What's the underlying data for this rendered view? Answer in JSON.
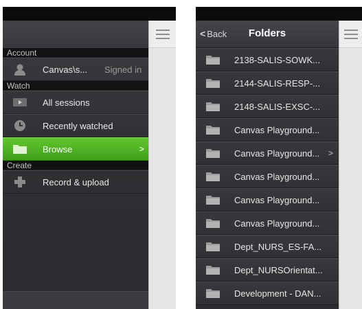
{
  "left_panel": {
    "sections": [
      {
        "header": "Account",
        "items": [
          {
            "label": "Canvas\\s...",
            "status": "Signed in",
            "icon": "person-icon"
          }
        ]
      },
      {
        "header": "Watch",
        "items": [
          {
            "label": "All sessions",
            "icon": "video-icon"
          },
          {
            "label": "Recently watched",
            "icon": "clock-icon"
          },
          {
            "label": "Browse",
            "icon": "folder-icon",
            "selected": true,
            "chevron": ">"
          }
        ]
      },
      {
        "header": "Create",
        "items": [
          {
            "label": "Record & upload",
            "icon": "plus-icon"
          }
        ]
      }
    ]
  },
  "right_panel": {
    "back_label": "Back",
    "back_chevron": "<",
    "title": "Folders",
    "folders": [
      "2138-SALIS-SOWK...",
      "2144-SALIS-RESP-...",
      "2148-SALIS-EXSC-...",
      "Canvas Playground...",
      "Canvas Playground...",
      "Canvas Playground...",
      "Canvas Playground...",
      "Canvas Playground...",
      "Dept_NURS_ES-FA...",
      "Dept_NURSOrientat...",
      "Development - DAN..."
    ],
    "row_chevron": ">"
  },
  "colors": {
    "accent_green": "#4fb323",
    "drawer_bg": "#2f3033",
    "section_header_bg": "#121214"
  }
}
